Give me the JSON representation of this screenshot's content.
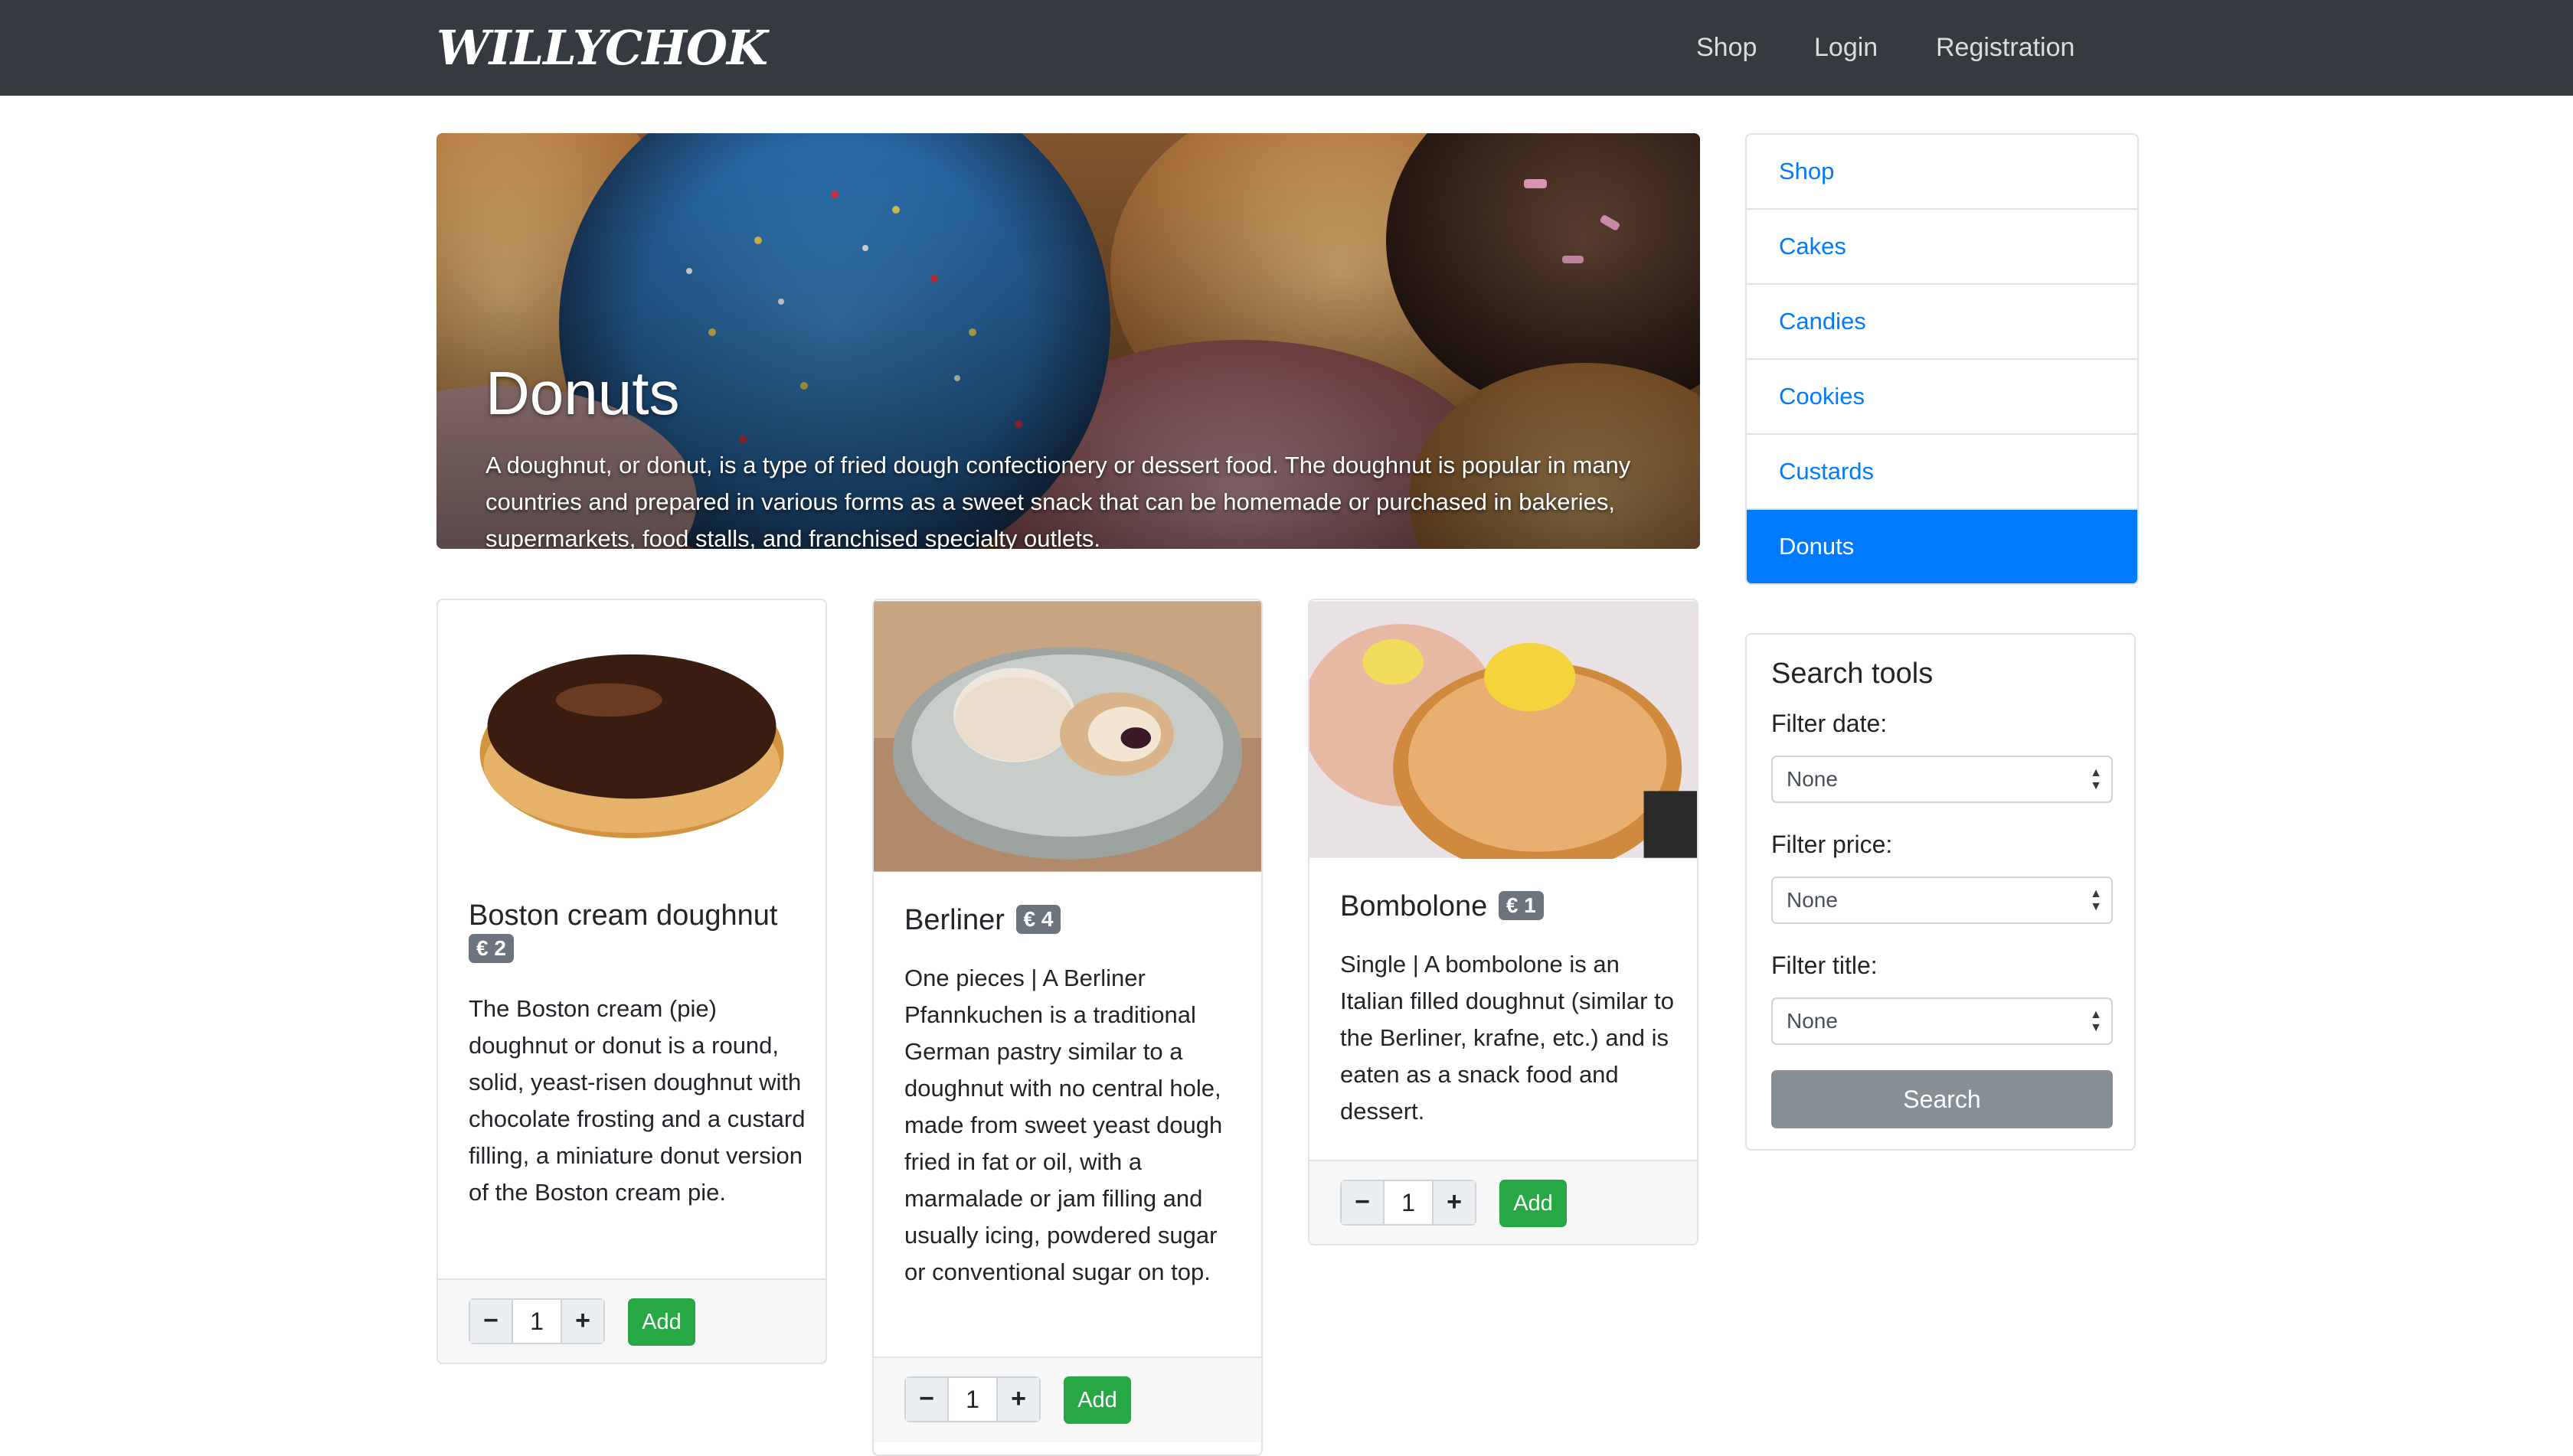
{
  "navbar": {
    "brand": "WILLYCHOK",
    "links": [
      "Shop",
      "Login",
      "Registration"
    ]
  },
  "hero": {
    "title": "Donuts",
    "text": "A doughnut, or donut, is a type of fried dough confectionery or dessert food. The doughnut is popular in many countries and prepared in various forms as a sweet snack that can be homemade or purchased in bakeries, supermarkets, food stalls, and franchised specialty outlets."
  },
  "categories": {
    "items": [
      "Shop",
      "Cakes",
      "Candies",
      "Cookies",
      "Custards",
      "Donuts"
    ],
    "active": "Donuts"
  },
  "search_tools": {
    "title": "Search tools",
    "filter_date_label": "Filter date:",
    "filter_date_value": "None",
    "filter_price_label": "Filter price:",
    "filter_price_value": "None",
    "filter_title_label": "Filter title:",
    "filter_title_value": "None",
    "search_button": "Search"
  },
  "products": [
    {
      "name": "Boston cream doughnut",
      "price": "€ 2",
      "description": "The Boston cream (pie) doughnut or donut is a round, solid, yeast-risen doughnut with chocolate frosting and a custard filling, a miniature donut version of the Boston cream pie.",
      "quantity": "1",
      "add_label": "Add"
    },
    {
      "name": "Berliner",
      "price": "€ 4",
      "description": "One pieces | A Berliner Pfannkuchen is a traditional German pastry similar to a doughnut with no central hole, made from sweet yeast dough fried in fat or oil, with a marmalade or jam filling and usually icing, powdered sugar or conventional sugar on top.",
      "quantity": "1",
      "add_label": "Add"
    },
    {
      "name": "Bombolone",
      "price": "€ 1",
      "description": "Single | A bombolone is an Italian filled doughnut (similar to the Berliner, krafne, etc.) and is eaten as a snack food and dessert.",
      "quantity": "1",
      "add_label": "Add"
    }
  ],
  "stepper": {
    "minus": "−",
    "plus": "+"
  },
  "colors": {
    "navbar": "#343a40",
    "primary": "#007bff",
    "success": "#28a745",
    "secondary": "#6c757d",
    "search_button": "#868e96"
  },
  "icons": [
    "select-arrows-icon"
  ]
}
